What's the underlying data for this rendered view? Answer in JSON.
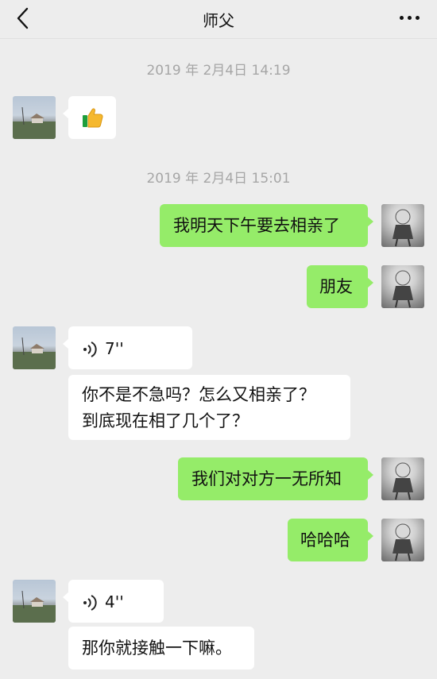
{
  "nav": {
    "title": "师父",
    "back_icon": "chevron-left-icon",
    "more_icon": "more-dots-icon"
  },
  "messages": {
    "timestamp_1": "2019 年 2月4日 14:19",
    "timestamp_2": "2019 年 2月4日 15:01",
    "m1_emoji": "thumbs-up-icon",
    "m2_text": "我明天下午要去相亲了",
    "m3_text": "朋友",
    "m4_voice_length": "7''",
    "m5_line1": "你不是不急吗？怎么又相亲了？",
    "m5_line2": "到底现在相了几个了？",
    "m6_text": "我们对对方一无所知",
    "m7_text": "哈哈哈",
    "m8_voice_length": "4''",
    "m9_text": "那你就接触一下嘛。"
  },
  "colors": {
    "background": "#ededed",
    "bubble_self": "#95ec69",
    "bubble_other": "#ffffff",
    "timestamp_text": "#a6a6a6"
  }
}
